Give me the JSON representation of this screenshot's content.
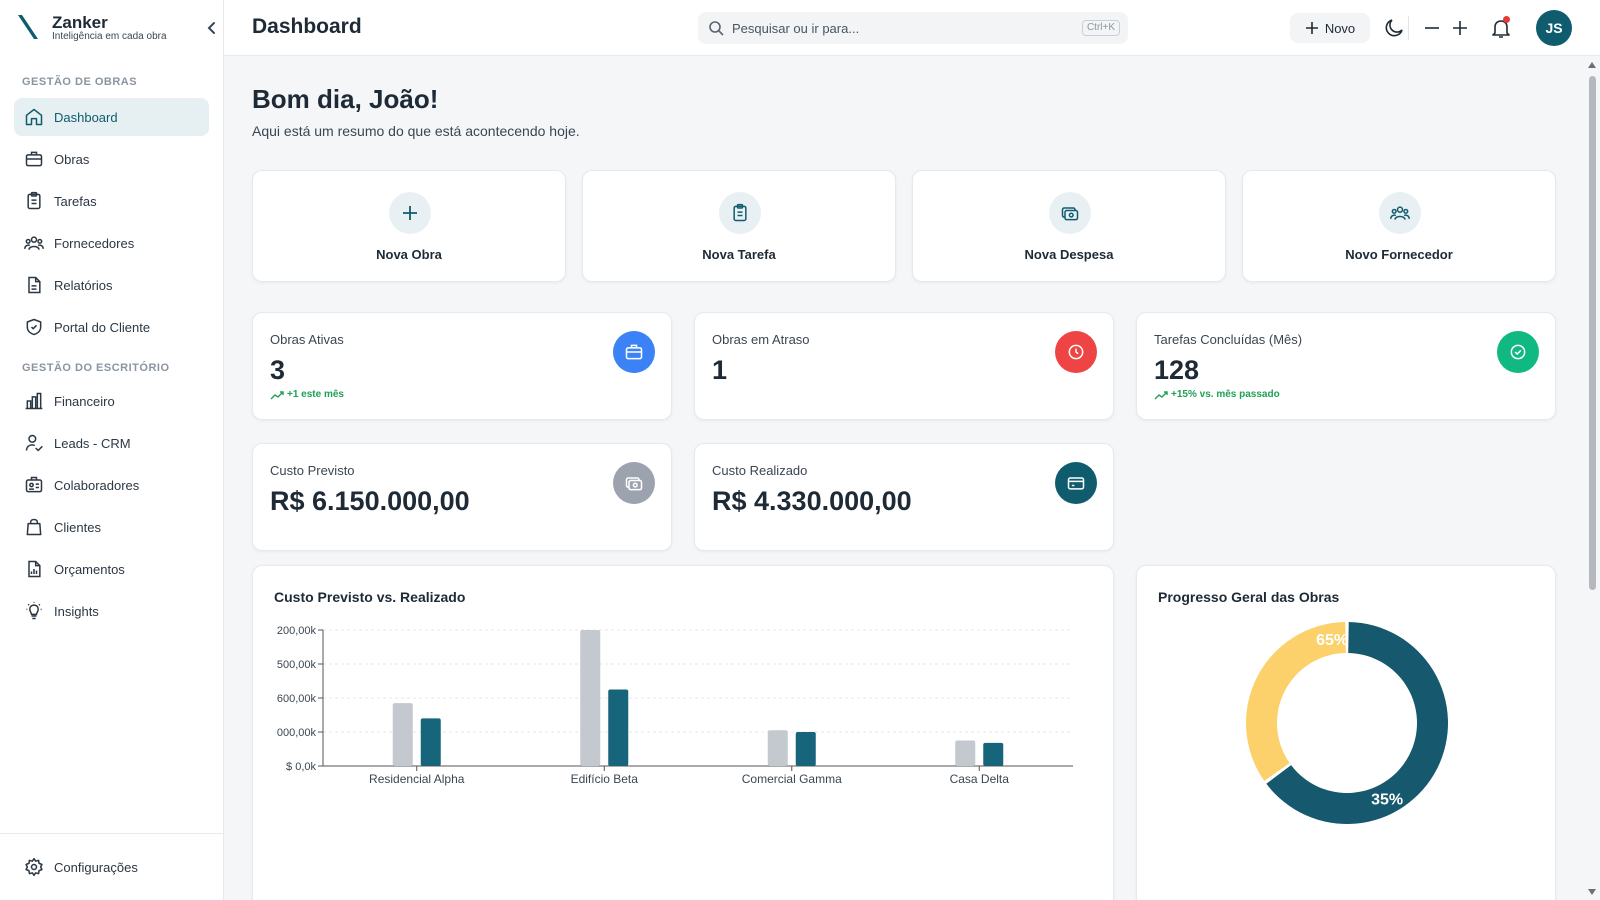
{
  "brand": {
    "name": "Zanker",
    "tagline": "Inteligência em cada obra"
  },
  "sidebar": {
    "section_obras": "GESTÃO DE OBRAS",
    "section_escritorio": "GESTÃO DO ESCRITÓRIO",
    "items": [
      {
        "label": "Dashboard",
        "icon": "home-icon",
        "active": true
      },
      {
        "label": "Obras",
        "icon": "briefcase-icon"
      },
      {
        "label": "Tarefas",
        "icon": "clipboard-icon"
      },
      {
        "label": "Fornecedores",
        "icon": "users-icon"
      },
      {
        "label": "Relatórios",
        "icon": "document-icon"
      },
      {
        "label": "Portal do Cliente",
        "icon": "shield-icon"
      },
      {
        "label": "Financeiro",
        "icon": "bar-chart-icon"
      },
      {
        "label": "Leads - CRM",
        "icon": "user-handshake-icon"
      },
      {
        "label": "Colaboradores",
        "icon": "id-badge-icon"
      },
      {
        "label": "Clientes",
        "icon": "shopping-bag-icon"
      },
      {
        "label": "Orçamentos",
        "icon": "report-icon"
      },
      {
        "label": "Insights",
        "icon": "lightbulb-icon"
      }
    ],
    "settings_label": "Configurações"
  },
  "topbar": {
    "title": "Dashboard",
    "search_placeholder": "Pesquisar ou ir para...",
    "search_shortcut": "Ctrl+K",
    "new_label": "Novo",
    "avatar_initials": "JS",
    "has_notifications": true
  },
  "greeting": {
    "title": "Bom dia, João!",
    "subtitle": "Aqui está um resumo do que está acontecendo hoje."
  },
  "quick_actions": [
    {
      "label": "Nova Obra",
      "icon": "plus-icon"
    },
    {
      "label": "Nova Tarefa",
      "icon": "clipboard-icon"
    },
    {
      "label": "Nova Despesa",
      "icon": "money-icon"
    },
    {
      "label": "Novo Fornecedor",
      "icon": "users-icon"
    }
  ],
  "stats": [
    {
      "label": "Obras Ativas",
      "value": "3",
      "trend": "+1 este mês",
      "icon": "briefcase-icon",
      "color": "#3b82f6"
    },
    {
      "label": "Obras em Atraso",
      "value": "1",
      "trend": "",
      "icon": "clock-icon",
      "color": "#ef4444"
    },
    {
      "label": "Tarefas Concluídas (Mês)",
      "value": "128",
      "trend": "+15% vs. mês passado",
      "icon": "check-circle-icon",
      "color": "#10b981"
    },
    {
      "label": "Custo Previsto",
      "value": "R$ 6.150.000,00",
      "trend": "",
      "icon": "money-icon",
      "color": "#9ca3af"
    },
    {
      "label": "Custo Realizado",
      "value": "R$ 4.330.000,00",
      "trend": "",
      "icon": "card-icon",
      "color": "#0f5c6e"
    }
  ],
  "charts": {
    "bar_title": "Custo Previsto vs. Realizado",
    "pie_title": "Progresso Geral das Obras"
  },
  "chart_data": [
    {
      "type": "bar",
      "title": "Custo Previsto vs. Realizado",
      "categories": [
        "Residencial Alpha",
        "Edifício Beta",
        "Comercial Gamma",
        "Casa Delta"
      ],
      "series": [
        {
          "values": [
            1850,
            4000,
            1050,
            750
          ],
          "color": "#c4c8cf"
        },
        {
          "values": [
            1400,
            2250,
            1000,
            680
          ],
          "color": "#16657a"
        }
      ],
      "y_tick_labels": [
        "$ 0,0k",
        "000,00k",
        "600,00k",
        "500,00k",
        "200,00k"
      ],
      "ylim": [
        0,
        4000
      ],
      "grid": true
    },
    {
      "type": "pie",
      "title": "Progresso Geral das Obras",
      "slices": [
        {
          "value": 65,
          "label": "65%",
          "color": "#16586e"
        },
        {
          "value": 35,
          "label": "35%",
          "color": "#fcd16b"
        }
      ]
    }
  ]
}
